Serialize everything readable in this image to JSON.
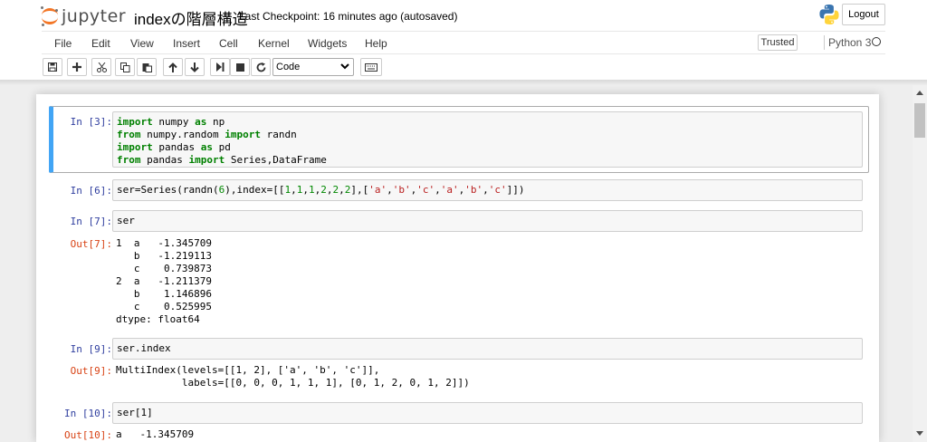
{
  "header": {
    "logo_text": "jupyter",
    "notebook_name": "indexの階層構造",
    "checkpoint": "Last Checkpoint: 16 minutes ago (autosaved)",
    "logout_label": "Logout"
  },
  "menu": [
    "File",
    "Edit",
    "View",
    "Insert",
    "Cell",
    "Kernel",
    "Widgets",
    "Help"
  ],
  "trusted_label": "Trusted",
  "kernel_name": "Python 3",
  "toolbar": {
    "icons": [
      "save-icon",
      "plus-icon",
      "cut-icon",
      "copy-icon",
      "paste-icon",
      "arrow-up-icon",
      "arrow-down-icon",
      "step-forward-icon",
      "stop-icon",
      "restart-icon",
      "keyboard-icon"
    ],
    "cell_type": "Code"
  },
  "cells": [
    {
      "prompt": "In [3]:",
      "lines": [
        [
          [
            "kw",
            "import"
          ],
          [
            "t",
            " numpy "
          ],
          [
            "kw",
            "as"
          ],
          [
            "t",
            " np"
          ]
        ],
        [
          [
            "kw",
            "from"
          ],
          [
            "t",
            " numpy.random "
          ],
          [
            "kw",
            "import"
          ],
          [
            "t",
            " randn"
          ]
        ],
        [
          [
            "kw",
            "import"
          ],
          [
            "t",
            " pandas "
          ],
          [
            "kw",
            "as"
          ],
          [
            "t",
            " pd"
          ]
        ],
        [
          [
            "kw",
            "from"
          ],
          [
            "t",
            " pandas "
          ],
          [
            "kw",
            "import"
          ],
          [
            "t",
            " Series,DataFrame"
          ]
        ]
      ]
    },
    {
      "prompt": "In [6]:",
      "lines": [
        [
          [
            "t",
            "ser=Series(randn("
          ],
          [
            "num",
            "6"
          ],
          [
            "t",
            "),index=[["
          ],
          [
            "num",
            "1"
          ],
          [
            "t",
            ","
          ],
          [
            "num",
            "1"
          ],
          [
            "t",
            ","
          ],
          [
            "num",
            "1"
          ],
          [
            "t",
            ","
          ],
          [
            "num",
            "2"
          ],
          [
            "t",
            ","
          ],
          [
            "num",
            "2"
          ],
          [
            "t",
            ","
          ],
          [
            "num",
            "2"
          ],
          [
            "t",
            "],["
          ],
          [
            "str",
            "'a'"
          ],
          [
            "t",
            ","
          ],
          [
            "str",
            "'b'"
          ],
          [
            "t",
            ","
          ],
          [
            "str",
            "'c'"
          ],
          [
            "t",
            ","
          ],
          [
            "str",
            "'a'"
          ],
          [
            "t",
            ","
          ],
          [
            "str",
            "'b'"
          ],
          [
            "t",
            ","
          ],
          [
            "str",
            "'c'"
          ],
          [
            "t",
            "]])"
          ]
        ]
      ]
    },
    {
      "prompt": "In [7]:",
      "lines": [
        [
          [
            "t",
            "ser"
          ]
        ]
      ],
      "out_prompt": "Out[7]:",
      "output": "1  a   -1.345709\n   b   -1.219113\n   c    0.739873\n2  a   -1.211379\n   b    1.146896\n   c    0.525995\ndtype: float64"
    },
    {
      "prompt": "In [9]:",
      "lines": [
        [
          [
            "t",
            "ser.index"
          ]
        ]
      ],
      "out_prompt": "Out[9]:",
      "output": "MultiIndex(levels=[[1, 2], ['a', 'b', 'c']],\n           labels=[[0, 0, 0, 1, 1, 1], [0, 1, 2, 0, 1, 2]])"
    },
    {
      "prompt": "In [10]:",
      "lines": [
        [
          [
            "t",
            "ser[1]"
          ]
        ]
      ],
      "out_prompt": "Out[10]:",
      "output": "a   -1.345709"
    }
  ]
}
